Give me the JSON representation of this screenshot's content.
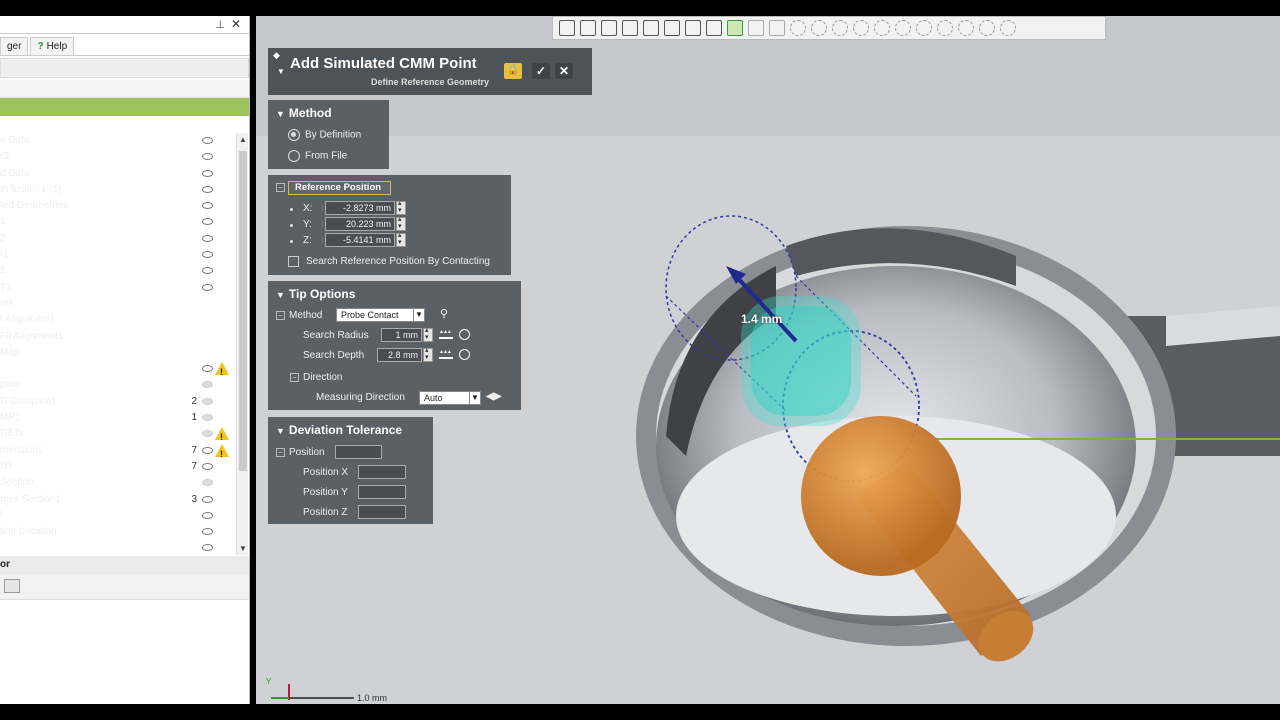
{
  "tree": {
    "tabs": [
      "ger",
      "Help"
    ],
    "rows": [
      {
        "label": "e Data",
        "eye": true,
        "dim": false,
        "count": "",
        "warn": false
      },
      {
        "label": "r3",
        "eye": true,
        "dim": false,
        "count": "",
        "warn": false
      },
      {
        "label": "d Data",
        "eye": true,
        "dim": false,
        "count": "",
        "warn": false
      },
      {
        "label": "th fusion 1 (1)",
        "eye": true,
        "dim": false,
        "count": "",
        "warn": false
      },
      {
        "label": "ted Geometries",
        "eye": true,
        "dim": false,
        "count": "",
        "warn": false
      },
      {
        "label": "1",
        "eye": true,
        "dim": false,
        "count": "",
        "warn": false
      },
      {
        "label": "2",
        "eye": true,
        "dim": false,
        "count": "",
        "warn": false
      },
      {
        "label": "r1",
        "eye": true,
        "dim": false,
        "count": "",
        "warn": false
      },
      {
        "label": "1",
        "eye": true,
        "dim": false,
        "count": "",
        "warn": false
      },
      {
        "label": "T1",
        "eye": true,
        "dim": false,
        "count": "",
        "warn": false
      },
      {
        "label": "nts",
        "eye": false,
        "dim": false,
        "count": "",
        "warn": false
      },
      {
        "label": "t Alignment1",
        "eye": false,
        "dim": false,
        "count": "",
        "warn": false
      },
      {
        "label": "Fit Alignment1",
        "eye": false,
        "dim": false,
        "count": "",
        "warn": false
      },
      {
        "label": "Map",
        "eye": false,
        "dim": false,
        "count": "",
        "warn": false
      },
      {
        "label": "",
        "eye": true,
        "dim": false,
        "count": "",
        "warn": true
      },
      {
        "label": "pare",
        "eye": true,
        "dim": true,
        "count": "",
        "warn": false
      },
      {
        "label": "D Compare1",
        "eye": true,
        "dim": true,
        "count": "2",
        "warn": false
      },
      {
        "label": "MP1",
        "eye": true,
        "dim": true,
        "count": "1",
        "warn": false
      },
      {
        "label": "D&Ts",
        "eye": true,
        "dim": true,
        "count": "",
        "warn": true
      },
      {
        "label": "mensions",
        "eye": true,
        "dim": false,
        "count": "7",
        "warn": true
      },
      {
        "label": "DT",
        "eye": true,
        "dim": false,
        "count": "7",
        "warn": false
      },
      {
        "label": " Section",
        "eye": true,
        "dim": true,
        "count": "",
        "warn": false
      },
      {
        "label": "ross Section1",
        "eye": true,
        "dim": false,
        "count": "3",
        "warn": false
      },
      {
        "label": "l",
        "eye": true,
        "dim": false,
        "count": "",
        "warn": false
      },
      {
        "label": "tion Location",
        "eye": true,
        "dim": false,
        "count": "",
        "warn": false
      },
      {
        "label": "",
        "eye": true,
        "dim": false,
        "count": "",
        "warn": false
      }
    ],
    "footer": "or"
  },
  "dialog": {
    "title": "Add Simulated CMM Point",
    "subtitle": "Define Reference Geometry",
    "method": {
      "header": "Method",
      "options": [
        "By Definition",
        "From File"
      ],
      "selected": "By Definition"
    },
    "reference": {
      "button": "Reference Position",
      "x_label": "X:",
      "x": "-2.8273 mm",
      "y_label": "Y:",
      "y": "20.223 mm",
      "z_label": "Z:",
      "z": "-5.4141 mm",
      "search_label": "Search Reference Position By Contacting"
    },
    "tip": {
      "header": "Tip Options",
      "method_label": "Method",
      "method_value": "Probe Contact",
      "radius_label": "Search Radius",
      "radius_value": "1 mm",
      "depth_label": "Search Depth",
      "depth_value": "2.8 mm",
      "direction_label": "Direction",
      "measuring_label": "Measuring Direction",
      "measuring_value": "Auto"
    },
    "deviation": {
      "header": "Deviation Tolerance",
      "position_label": "Position",
      "px_label": "Position X",
      "py_label": "Position Y",
      "pz_label": "Position Z"
    }
  },
  "viewport": {
    "measure_label": "1.4 mm",
    "scale_label": "1.0 mm",
    "axis_y": "Y"
  },
  "colors": {
    "panel": "#5b5f66",
    "accent_green": "#9cc35a",
    "probe_orange": "#d98a35",
    "point_cloud": "#3ee0d0"
  }
}
